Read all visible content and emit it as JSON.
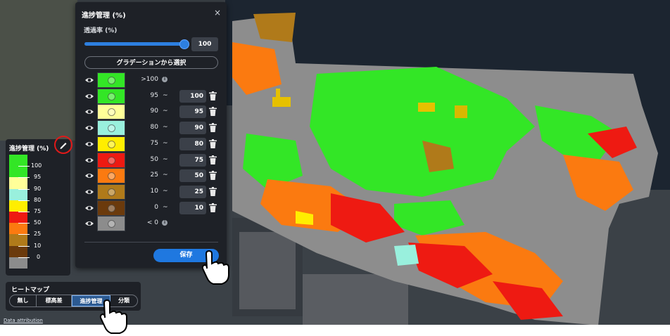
{
  "panel": {
    "title": "進捗管理 (%)",
    "close_glyph": "×",
    "opacity_label": "透過率 (%)",
    "opacity_value": "100",
    "opacity_fraction": 1.0,
    "gradient_button": "グラデーションから選択",
    "save_button": "保存",
    "rows": [
      {
        "color": "#33e626",
        "lo": ">100",
        "hi": "",
        "info": true
      },
      {
        "color": "#33e626",
        "lo": "95",
        "hi": "100"
      },
      {
        "color": "#ffff99",
        "lo": "90",
        "hi": "95"
      },
      {
        "color": "#99f0dd",
        "lo": "80",
        "hi": "90"
      },
      {
        "color": "#ffee00",
        "lo": "75",
        "hi": "80"
      },
      {
        "color": "#ee1a12",
        "lo": "50",
        "hi": "75"
      },
      {
        "color": "#fb7a10",
        "lo": "25",
        "hi": "50"
      },
      {
        "color": "#b07a1a",
        "lo": "10",
        "hi": "25"
      },
      {
        "color": "#6b3a0c",
        "lo": "0",
        "hi": "10"
      },
      {
        "color": "#8c8c8c",
        "lo": "< 0",
        "hi": "",
        "info": true
      }
    ]
  },
  "legend": {
    "title": "進捗管理 (%)",
    "labels": [
      "100",
      "95",
      "90",
      "80",
      "75",
      "50",
      "25",
      "10",
      "0"
    ]
  },
  "heatmap": {
    "title": "ヒートマップ",
    "options": [
      "無し",
      "標高差",
      "進捗管理",
      "分類"
    ],
    "selected": "進捗管理"
  },
  "attribution": "Data attribution",
  "colors": {
    "accent": "#1f78e0",
    "panel_bg": "#1e2127",
    "highlight_ring": "#e01919"
  }
}
